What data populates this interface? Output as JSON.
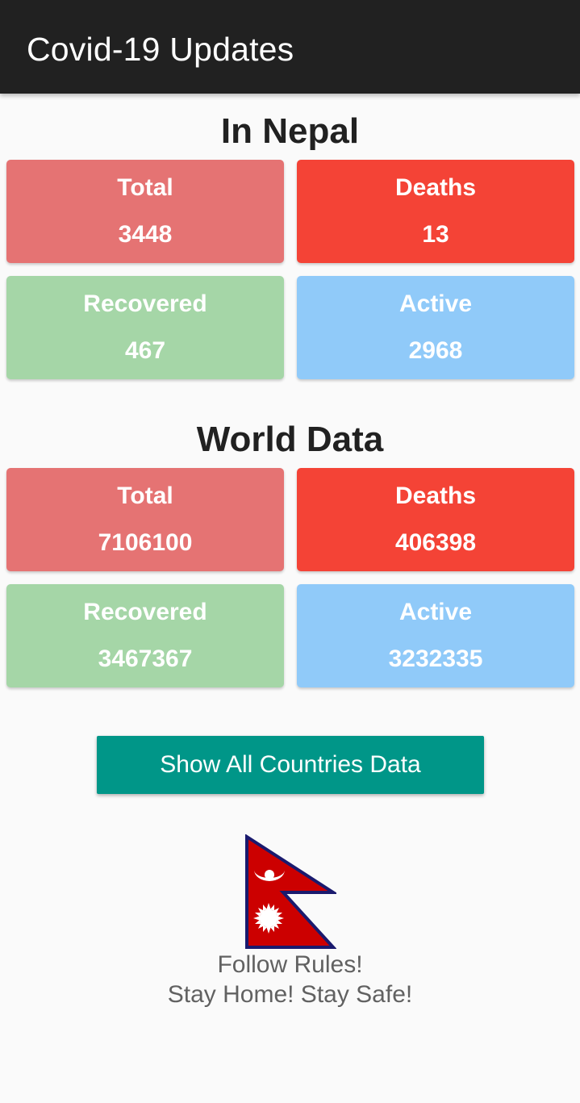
{
  "app": {
    "title": "Covid-19 Updates"
  },
  "nepal": {
    "heading": "In Nepal",
    "total": {
      "label": "Total",
      "value": "3448"
    },
    "deaths": {
      "label": "Deaths",
      "value": "13"
    },
    "recovered": {
      "label": "Recovered",
      "value": "467"
    },
    "active": {
      "label": "Active",
      "value": "2968"
    }
  },
  "world": {
    "heading": "World Data",
    "total": {
      "label": "Total",
      "value": "7106100"
    },
    "deaths": {
      "label": "Deaths",
      "value": "406398"
    },
    "recovered": {
      "label": "Recovered",
      "value": "3467367"
    },
    "active": {
      "label": "Active",
      "value": "3232335"
    }
  },
  "button": {
    "label": "Show All Countries Data"
  },
  "footer": {
    "line1": "Follow Rules!",
    "line2": "Stay Home! Stay Safe!"
  },
  "colors": {
    "appbar": "#212121",
    "total": "#e57373",
    "deaths": "#f44336",
    "recovered": "#a5d6a7",
    "active": "#90caf9",
    "button": "#009688",
    "flag_red": "#cc0000",
    "flag_border": "#1a1a6e"
  },
  "icons": {
    "flag": "nepal-flag-icon"
  }
}
